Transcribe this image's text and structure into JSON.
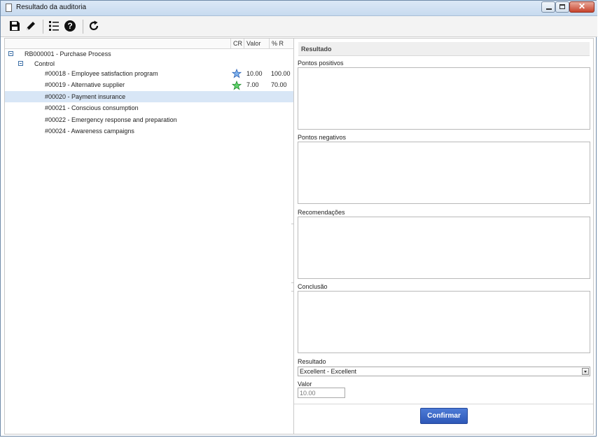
{
  "window": {
    "title": "Resultado da auditoria"
  },
  "toolbar": {
    "icons": [
      "save-icon",
      "edit-icon",
      "list-icon",
      "help-icon",
      "refresh-icon"
    ]
  },
  "tree": {
    "columns": {
      "cr": "CR",
      "valor": "Valor",
      "pr": "% R"
    },
    "root": "RB000001 - Purchase Process",
    "group": "Control",
    "items": [
      {
        "label": "#00018 - Employee satisfaction program",
        "cr": "blue-star-icon",
        "valor": "10.00",
        "pr": "100.00"
      },
      {
        "label": "#00019 - Alternative supplier",
        "cr": "green-star-icon",
        "valor": "7.00",
        "pr": "70.00"
      },
      {
        "label": "#00020 - Payment insurance",
        "selected": true
      },
      {
        "label": "#00021 - Conscious consumption"
      },
      {
        "label": "#00022 - Emergency response and preparation"
      },
      {
        "label": "#00024 - Awareness campaigns"
      }
    ]
  },
  "form": {
    "header": "Resultado",
    "pontos_positivos_label": "Pontos positivos",
    "pontos_negativos_label": "Pontos negativos",
    "recomendacoes_label": "Recomendações",
    "conclusao_label": "Conclusão",
    "resultado_label": "Resultado",
    "resultado_value": "Excellent - Excellent",
    "valor_label": "Valor",
    "valor_value": "10.00",
    "confirm_label": "Confirmar"
  },
  "colors": {
    "selection": "#d8e6f6",
    "confirm_button": "#3a67c6",
    "titlebar": "#d3e3f4"
  }
}
